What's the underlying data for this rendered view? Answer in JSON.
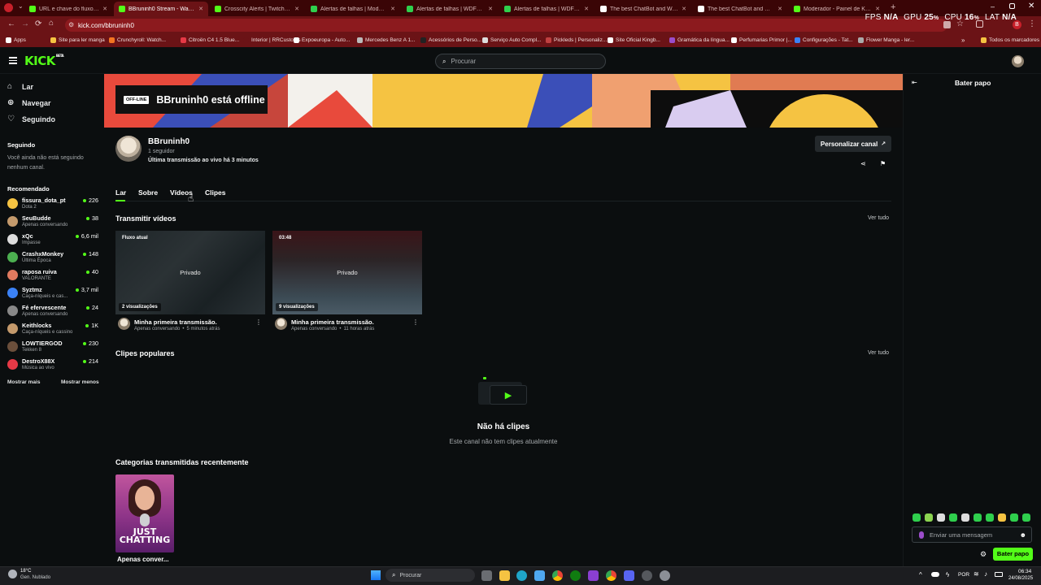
{
  "browser": {
    "tabs": [
      {
        "label": "URL e chave do fluxo - Painel d...",
        "icon_color": "#53fc18"
      },
      {
        "label": "BBruninh0 Stream - Watch Live...",
        "icon_color": "#53fc18",
        "active": true
      },
      {
        "label": "Crosscity Alerts | Twitch and Y...",
        "icon_color": "#53fc18"
      },
      {
        "label": "Alertas de falhas | Modelos d...",
        "icon_color": "#2fcf4d"
      },
      {
        "label": "Alertas de falhas | WDFLAT.com",
        "icon_color": "#2fcf4d"
      },
      {
        "label": "Alertas de falhas | WDFLAT.com",
        "icon_color": "#2fcf4d"
      },
      {
        "label": "The best ChatBot and Widgets...",
        "icon_color": "#ffffff"
      },
      {
        "label": "The best ChatBot and Widgets...",
        "icon_color": "#ffffff"
      },
      {
        "label": "Moderador - Painel de Kick",
        "icon_color": "#53fc18"
      }
    ],
    "url": "kick.com/bbruninh0",
    "bookmarks": [
      {
        "label": "Apps",
        "icon_color": "#ffffff"
      },
      {
        "label": "Site para ler manga",
        "icon_color": "#f5c342"
      },
      {
        "label": "Crunchyroll: Watch...",
        "icon_color": "#f47521"
      },
      {
        "label": "Citroën C4 1.5 Blue...",
        "icon_color": "#e63946"
      },
      {
        "label": "Interior | RRCustoms",
        "icon_color": "#6b1316"
      },
      {
        "label": "Expoeuropa - Auto...",
        "icon_color": "#ffffff"
      },
      {
        "label": "Mercedes Benz A 1...",
        "icon_color": "#bbbbbb"
      },
      {
        "label": "Acessórios de Perso...",
        "icon_color": "#222222"
      },
      {
        "label": "Serviço Auto Compl...",
        "icon_color": "#dddddd"
      },
      {
        "label": "Pickleds | Personaliz...",
        "icon_color": "#c04040"
      },
      {
        "label": "Site Oficial Kingb...",
        "icon_color": "#ffffff"
      },
      {
        "label": "Gramática da língua...",
        "icon_color": "#9b4dca"
      },
      {
        "label": "Perfumarias Primor |...",
        "icon_color": "#ffffff"
      },
      {
        "label": "Configurações - Tat...",
        "icon_color": "#3b82f6"
      },
      {
        "label": "Flower Manga - ler...",
        "icon_color": "#aaaaaa"
      },
      {
        "label": "Todos os marcadores",
        "icon_color": "#f5c342"
      }
    ],
    "perf": {
      "fps_label": "FPS",
      "fps": "N/A",
      "gpu_label": "GPU",
      "gpu": "25",
      "cpu_label": "CPU",
      "cpu": "16",
      "lat_label": "LAT",
      "lat": "N/A",
      "pct": "%"
    }
  },
  "header": {
    "logo": "KICK",
    "logo_badge": "BETA",
    "search_placeholder": "Procurar"
  },
  "sidebar": {
    "nav": [
      {
        "label": "Lar",
        "icon": "home-icon"
      },
      {
        "label": "Navegar",
        "icon": "compass-icon"
      },
      {
        "label": "Seguindo",
        "icon": "heart-icon"
      }
    ],
    "following_title": "Seguindo",
    "following_empty": "Você ainda não está seguindo nenhum canal.",
    "recommended_title": "Recomendado",
    "recommended": [
      {
        "name": "fissura_dota_pt",
        "category": "Dota 2",
        "viewers": "226",
        "color": "#f5c342"
      },
      {
        "name": "SeuBudde",
        "category": "Apenas conversando",
        "viewers": "38",
        "color": "#c49a6c"
      },
      {
        "name": "xQc",
        "category": "Impasse",
        "viewers": "6,6 mil",
        "color": "#dddddd"
      },
      {
        "name": "CrashxMonkey",
        "category": "Última Época",
        "viewers": "148",
        "color": "#4caf50"
      },
      {
        "name": "raposa ruiva",
        "category": "VALORANTE",
        "viewers": "40",
        "color": "#e07a5f"
      },
      {
        "name": "Syztmz",
        "category": "Caça-níqueis e cas...",
        "viewers": "3,7 mil",
        "color": "#3b82f6"
      },
      {
        "name": "Fé efervescente",
        "category": "Apenas conversando",
        "viewers": "24",
        "color": "#888888"
      },
      {
        "name": "Keithlocks",
        "category": "Caça-níqueis e cassino",
        "viewers": "1K",
        "color": "#c49a6c"
      },
      {
        "name": "LOWTIERGOD",
        "category": "Tekken 8",
        "viewers": "230",
        "color": "#6b4f3b"
      },
      {
        "name": "DestroX88X",
        "category": "Música ao vivo",
        "viewers": "214",
        "color": "#e63946"
      }
    ],
    "show_more": "Mostrar mais",
    "show_less": "Mostrar menos"
  },
  "channel": {
    "offline_tag": "OFF-LINE",
    "offline_title": "BBruninh0 está offline",
    "name": "BBruninh0",
    "followers": "1 seguidor",
    "last_live": "Última transmissão ao vivo há 3 minutos",
    "customize_button": "Personalizar canal",
    "tabs": [
      "Lar",
      "Sobre",
      "Vídeos",
      "Clipes"
    ],
    "stream_videos_title": "Transmitir vídeos",
    "see_all": "Ver tudo",
    "videos": [
      {
        "badge": "Fluxo atual",
        "private": "Privado",
        "views": "2 visualizações",
        "title": "Minha primeira transmissão.",
        "category": "Apenas conversando",
        "ago": "5 minutos atrás"
      },
      {
        "badge": "03:48",
        "private": "Privado",
        "views": "9 visualizações",
        "title": "Minha primeira transmissão.",
        "category": "Apenas conversando",
        "ago": "11 horas atrás"
      }
    ],
    "popular_clips_title": "Clipes populares",
    "no_clips_title": "Não há clipes",
    "no_clips_text": "Este canal não tem clipes atualmente",
    "categories_title": "Categorias transmitidas recentemente",
    "category_card": {
      "art_text": "JUST CHATTING",
      "label": "Apenas conver..."
    }
  },
  "chat": {
    "title": "Bater papo",
    "input_placeholder": "Enviar uma mensagem",
    "send_button": "Bater papo"
  },
  "taskbar": {
    "weather_temp": "18°C",
    "weather_text": "Gen. Nublado",
    "search_placeholder": "Procurar",
    "lang": "POR",
    "time": "06:34",
    "date": "24/08/2025"
  },
  "colors": {
    "accent": "#53fc18",
    "browser_dark": "#3a0506",
    "browser": "#6b1316",
    "bg": "#0b0e0f"
  }
}
